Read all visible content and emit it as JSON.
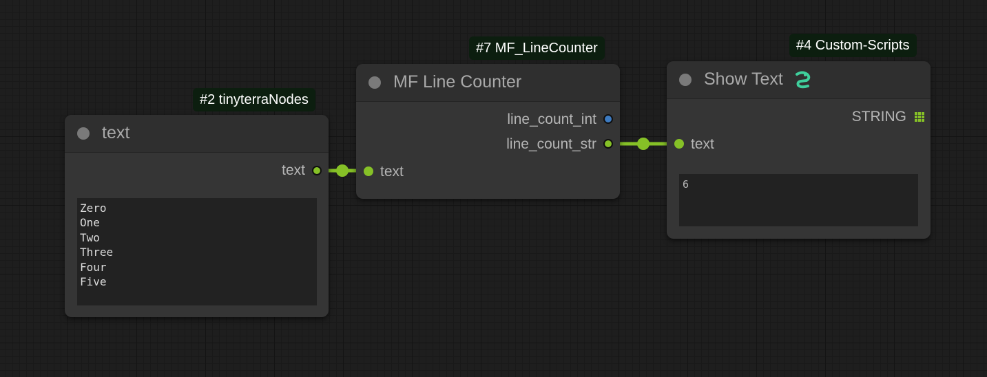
{
  "badges": {
    "node2": "#2 tinyterraNodes",
    "node7": "#7 MF_LineCounter",
    "node4": "#4 Custom-Scripts"
  },
  "nodes": {
    "text": {
      "title": "text",
      "output_label": "text",
      "lines": [
        "Zero",
        "One",
        "Two",
        "Three",
        "Four",
        "Five"
      ]
    },
    "line_counter": {
      "title": "MF Line Counter",
      "input_label": "text",
      "outputs": [
        "line_count_int",
        "line_count_str"
      ]
    },
    "show_text": {
      "title": "Show Text",
      "output_type": "STRING",
      "input_label": "text",
      "value": "6"
    }
  },
  "colors": {
    "link": "#86c127",
    "int_socket": "#3d7bc1",
    "custom_scripts_icon": "#3fcf9c"
  },
  "icons": {
    "show_text_title_icon": "snake-icon",
    "string_type_icon": "grid-icon"
  }
}
